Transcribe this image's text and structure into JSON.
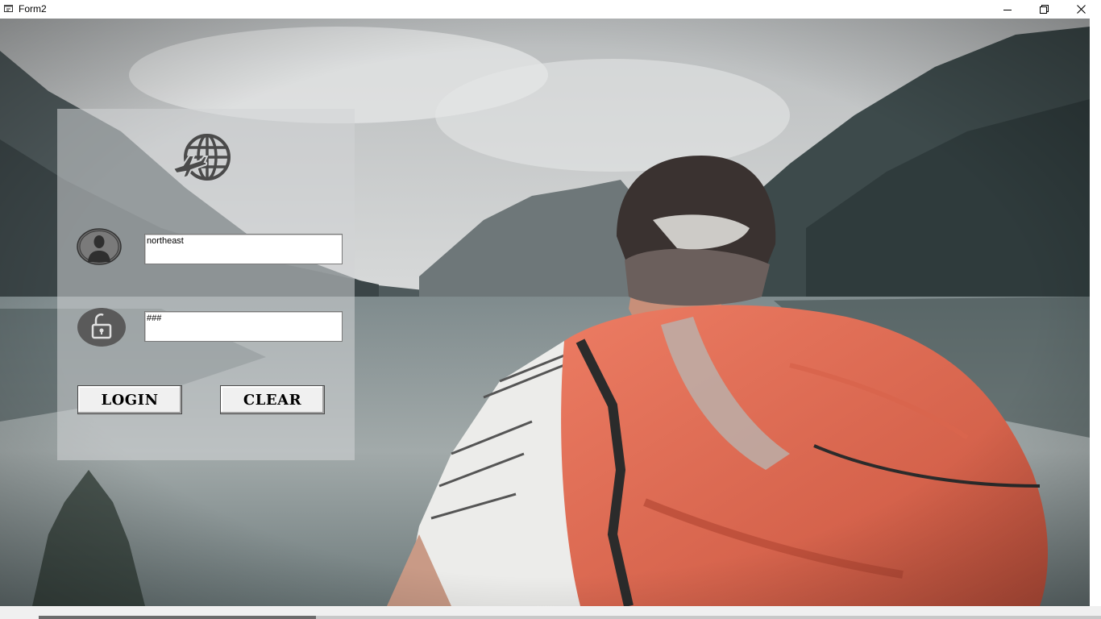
{
  "window": {
    "title": "Form2"
  },
  "login_form": {
    "username_value": "northeast",
    "password_value": "###",
    "login_label": "LOGIN",
    "clear_label": "CLEAR"
  },
  "icons": {
    "app": "form-icon",
    "logo": "travel-globe-plane-icon",
    "user": "user-avatar-icon",
    "password": "unlock-icon"
  },
  "colors": {
    "backpack": "#e0674f",
    "panel": "#d2d4d6",
    "button_face": "#f0f0f0"
  }
}
